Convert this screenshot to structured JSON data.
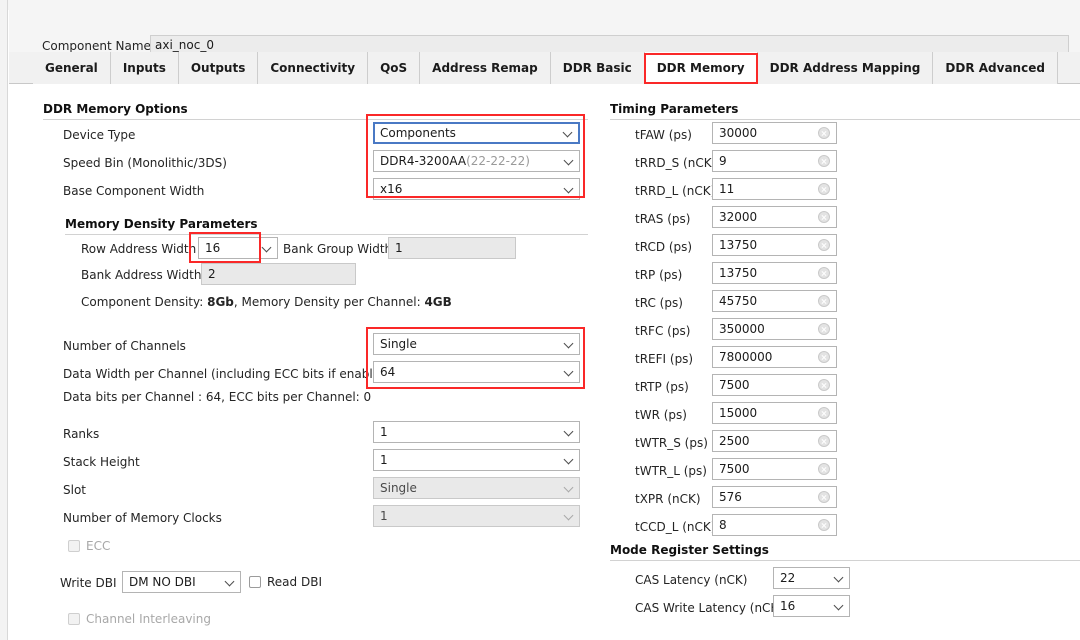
{
  "window": {
    "component_name_label": "Component Name",
    "component_name_value": "axi_noc_0"
  },
  "tabs": [
    {
      "label": "General",
      "active": false,
      "highlighted": false
    },
    {
      "label": "Inputs",
      "active": false,
      "highlighted": false
    },
    {
      "label": "Outputs",
      "active": false,
      "highlighted": false
    },
    {
      "label": "Connectivity",
      "active": false,
      "highlighted": false
    },
    {
      "label": "QoS",
      "active": false,
      "highlighted": false
    },
    {
      "label": "Address Remap",
      "active": false,
      "highlighted": false
    },
    {
      "label": "DDR Basic",
      "active": false,
      "highlighted": false
    },
    {
      "label": "DDR Memory",
      "active": true,
      "highlighted": true
    },
    {
      "label": "DDR Address Mapping",
      "active": false,
      "highlighted": false
    },
    {
      "label": "DDR Advanced",
      "active": false,
      "highlighted": false
    }
  ],
  "left_panel": {
    "section_title": "DDR Memory Options",
    "device_type": {
      "label": "Device Type",
      "value": "Components"
    },
    "speed_bin": {
      "label": "Speed Bin (Monolithic/3DS)",
      "value": "DDR4-3200AA",
      "value_suffix": "(22-22-22)"
    },
    "base_component_width": {
      "label": "Base Component Width",
      "value": "x16"
    },
    "memory_density_title": "Memory Density Parameters",
    "row_address_width": {
      "label": "Row Address Width",
      "value": "16"
    },
    "bank_group_width": {
      "label": "Bank Group Width",
      "value": "1"
    },
    "bank_address_width": {
      "label": "Bank Address Width",
      "value": "2"
    },
    "density_info": {
      "prefix": "Component Density: ",
      "component_density": "8Gb",
      "middle": ", Memory Density per Channel: ",
      "memory_density": "4GB"
    },
    "number_of_channels": {
      "label": "Number of Channels",
      "value": "Single"
    },
    "data_width_per_channel": {
      "label": "Data Width per Channel (including ECC bits if enabled)",
      "value": "64"
    },
    "data_bits_info": "Data bits per Channel : 64, ECC bits per Channel: 0",
    "ranks": {
      "label": "Ranks",
      "value": "1"
    },
    "stack_height": {
      "label": "Stack Height",
      "value": "1"
    },
    "slot": {
      "label": "Slot",
      "value": "Single"
    },
    "number_of_memory_clocks": {
      "label": "Number of Memory Clocks",
      "value": "1"
    },
    "ecc_checkbox": {
      "label": "ECC",
      "checked": false,
      "enabled": false
    },
    "write_dbi": {
      "label": "Write DBI",
      "value": "DM NO DBI"
    },
    "read_dbi_checkbox": {
      "label": "Read DBI",
      "checked": false,
      "enabled": true
    },
    "channel_interleaving_checkbox": {
      "label": "Channel Interleaving",
      "checked": false,
      "enabled": false
    }
  },
  "right_panel": {
    "timing_title": "Timing Parameters",
    "timing_params": [
      {
        "label": "tFAW (ps)",
        "value": "30000"
      },
      {
        "label": "tRRD_S (nCK)",
        "value": "9"
      },
      {
        "label": "tRRD_L (nCK)",
        "value": "11"
      },
      {
        "label": "tRAS (ps)",
        "value": "32000"
      },
      {
        "label": "tRCD (ps)",
        "value": "13750"
      },
      {
        "label": "tRP (ps)",
        "value": "13750"
      },
      {
        "label": "tRC (ps)",
        "value": "45750"
      },
      {
        "label": "tRFC (ps)",
        "value": "350000"
      },
      {
        "label": "tREFI (ps)",
        "value": "7800000"
      },
      {
        "label": "tRTP (ps)",
        "value": "7500"
      },
      {
        "label": "tWR (ps)",
        "value": "15000"
      },
      {
        "label": "tWTR_S (ps)",
        "value": "2500"
      },
      {
        "label": "tWTR_L (ps)",
        "value": "7500"
      },
      {
        "label": "tXPR (nCK)",
        "value": "576"
      },
      {
        "label": "tCCD_L (nCK)",
        "value": "8"
      }
    ],
    "mode_register_title": "Mode Register Settings",
    "cas_latency": {
      "label": "CAS Latency (nCK)",
      "value": "22"
    },
    "cas_write_latency": {
      "label": "CAS Write Latency (nCK)",
      "value": "16"
    }
  },
  "colors": {
    "annotation": "#fa2828",
    "focus": "#4a79c4",
    "panel_bg": "#f5f5f5"
  }
}
